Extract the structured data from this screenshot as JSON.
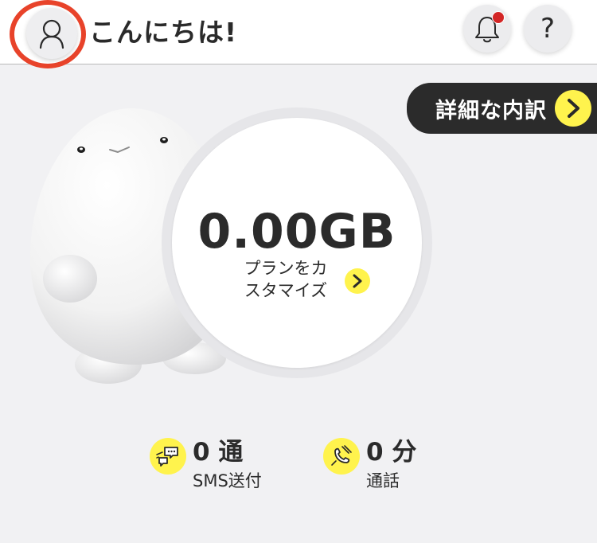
{
  "header": {
    "greeting": "こんにちは!",
    "avatar_icon": "user-icon",
    "notification_icon": "bell-icon",
    "help_label": "?",
    "highlight_color": "#e8432a",
    "badge_color": "#d32626"
  },
  "details": {
    "label": "詳細な内訳",
    "arrow_icon": "chevron-right-icon"
  },
  "usage": {
    "data_amount": "0.00GB",
    "plan_label": "プランをカスタマイズ",
    "plan_arrow_icon": "chevron-right-icon"
  },
  "stats": {
    "sms": {
      "value": "0 通",
      "label": "SMS送付",
      "icon": "message-icon"
    },
    "calls": {
      "value": "0 分",
      "label": "通話",
      "icon": "phone-icon"
    }
  },
  "colors": {
    "accent": "#fff34d",
    "dark": "#2b2b2b",
    "background": "#f1f1f3"
  }
}
